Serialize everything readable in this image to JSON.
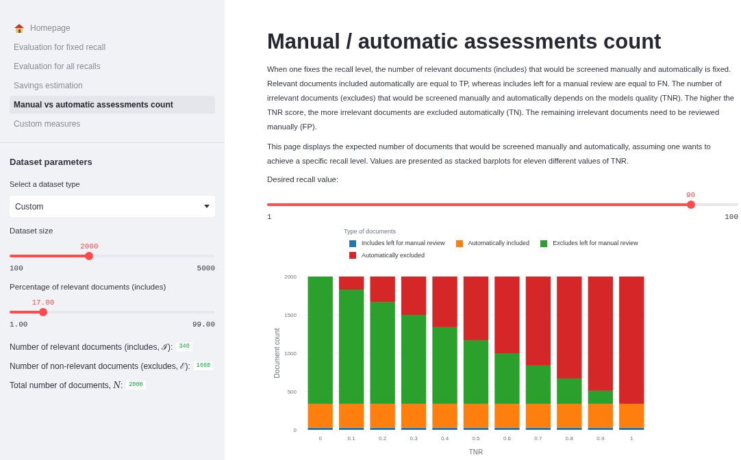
{
  "sidebar": {
    "nav": [
      {
        "label": "Homepage",
        "kind": "home",
        "selected": false
      },
      {
        "label": "Evaluation for fixed recall",
        "kind": "page",
        "selected": false
      },
      {
        "label": "Evaluation for all recalls",
        "kind": "page",
        "selected": false
      },
      {
        "label": "Savings estimation",
        "kind": "page",
        "selected": false
      },
      {
        "label": "Manual vs automatic assessments count",
        "kind": "page",
        "selected": true
      },
      {
        "label": "Custom measures",
        "kind": "page",
        "selected": false
      }
    ],
    "heading": "Dataset parameters",
    "select": {
      "label": "Select a dataset type",
      "value": "Custom"
    },
    "sliders": [
      {
        "label": "Dataset size",
        "value": "2000",
        "min": "100",
        "max": "5000",
        "level": 0.388
      },
      {
        "label": "Percentage of relevant documents (includes)",
        "value": "17.00",
        "min": "1.00",
        "max": "99.00",
        "level": 0.163
      }
    ],
    "stats": [
      {
        "label": "Number of relevant documents (includes, ",
        "symbol": "ℐ",
        "suffix": "):",
        "value": "340"
      },
      {
        "label": "Number of non-relevant documents (excludes, ",
        "symbol": "ℰ",
        "suffix": "):",
        "value": "1660"
      },
      {
        "label": "Total number of documents, ",
        "symbol": "N",
        "suffix": ":",
        "value": "2000"
      }
    ]
  },
  "main": {
    "title": "Manual / automatic assessments count",
    "paragraphs": [
      "When one fixes the recall level, the number of relevant documents (includes) that would be screened manually and automatically is fixed. Relevant documents included automatically are equal to TP, whereas includes left for a manual review are equal to FN. The number of irrelevant documents (excludes) that would be screened manually and automatically depends on the models quality (TNR). The higher the TNR score, the more irrelevant documents are excluded automatically (TN). The remaining irrelevant documents need to be reviewed manually (FP).",
      "This page displays the expected number of documents that would be screened manually and automatically, assuming one wants to achieve a specific recall level. Values are presented as stacked barplots for eleven different values of TNR."
    ],
    "recall_slider": {
      "label": "Desired recall value:",
      "value": "90",
      "min": "1",
      "max": "100",
      "level": 0.899
    },
    "chart": {
      "legend_title": "Type of documents",
      "chart_data": {
        "type": "bar",
        "stacked": true,
        "xlabel": "TNR",
        "ylabel": "Document count",
        "categories": [
          "0",
          "0.1",
          "0.2",
          "0.3",
          "0.4",
          "0.5",
          "0.6",
          "0.7",
          "0.8",
          "0.9",
          "1"
        ],
        "ylim": [
          0,
          2000
        ],
        "yticks": [
          {
            "value": 0,
            "label": "0"
          },
          {
            "value": 500,
            "label": "500"
          },
          {
            "value": 1000,
            "label": "1000"
          },
          {
            "value": 1500,
            "label": "1500"
          },
          {
            "value": 2000,
            "label": "2000"
          }
        ],
        "grid": true,
        "legend": true,
        "series": [
          {
            "name": "Includes left for manual review",
            "color": "#1f77b4",
            "values": [
              30,
              30,
              30,
              30,
              30,
              30,
              30,
              30,
              30,
              30,
              30
            ]
          },
          {
            "name": "Automatically included",
            "color": "#ff7f0e",
            "values": [
              310,
              310,
              310,
              310,
              310,
              310,
              310,
              310,
              310,
              310,
              310
            ]
          },
          {
            "name": "Excludes left for manual review",
            "color": "#2ca02c",
            "values": [
              1660,
              1490,
              1330,
              1160,
              1000,
              830,
              660,
              500,
              330,
              170,
              0
            ]
          },
          {
            "name": "Automatically excluded",
            "color": "#d62728",
            "values": [
              0,
              170,
              330,
              500,
              660,
              830,
              1000,
              1160,
              1330,
              1490,
              1660
            ]
          }
        ]
      }
    }
  }
}
